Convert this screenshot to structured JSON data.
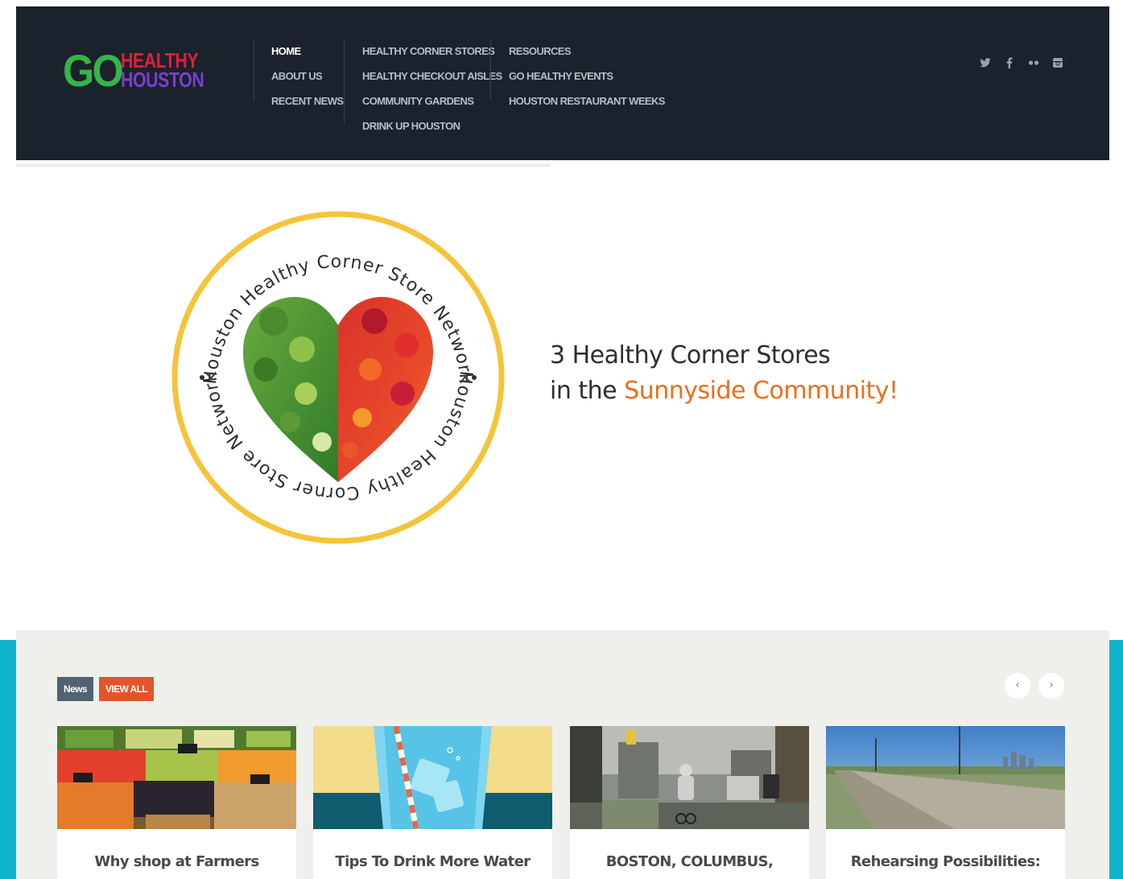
{
  "brand": {
    "logo_go": "GO",
    "logo_healthy": "HEALTHY",
    "logo_houston": "HOUSTON"
  },
  "nav": {
    "col1": [
      "HOME",
      "ABOUT US",
      "RECENT NEWS"
    ],
    "col2": [
      "HEALTHY CORNER STORES",
      "HEALTHY CHECKOUT AISLES",
      "COMMUNITY GARDENS",
      "DRINK UP HOUSTON"
    ],
    "col3": [
      "RESOURCES",
      "GO HEALTHY EVENTS",
      "HOUSTON RESTAURANT WEEKS"
    ],
    "active": "HOME"
  },
  "social": [
    "twitter-icon",
    "facebook-icon",
    "flickr-icon",
    "instagram-icon"
  ],
  "hero": {
    "badge_top_text": "Houston Healthy Corner Store Network",
    "badge_bottom_text": "Houston Healthy Corner Store Network",
    "line1": "3 Healthy Corner Stores",
    "line2_prefix": "in the",
    "line2_highlight": "Sunnyside Community!"
  },
  "news": {
    "tag": "News",
    "view_all": "VIEW ALL",
    "prev_label": "‹",
    "next_label": "›",
    "cards": [
      {
        "title": "Why shop at Farmers"
      },
      {
        "title": "Tips To Drink More Water"
      },
      {
        "title": "BOSTON, COLUMBUS,"
      },
      {
        "title": "Rehearsing Possibilities:"
      }
    ]
  },
  "colors": {
    "header_bg": "#1b222b",
    "accent_orange": "#ee6d1b",
    "tag_news": "#526273",
    "tag_viewall": "#e2552b",
    "teal": "#0eb3cc"
  }
}
